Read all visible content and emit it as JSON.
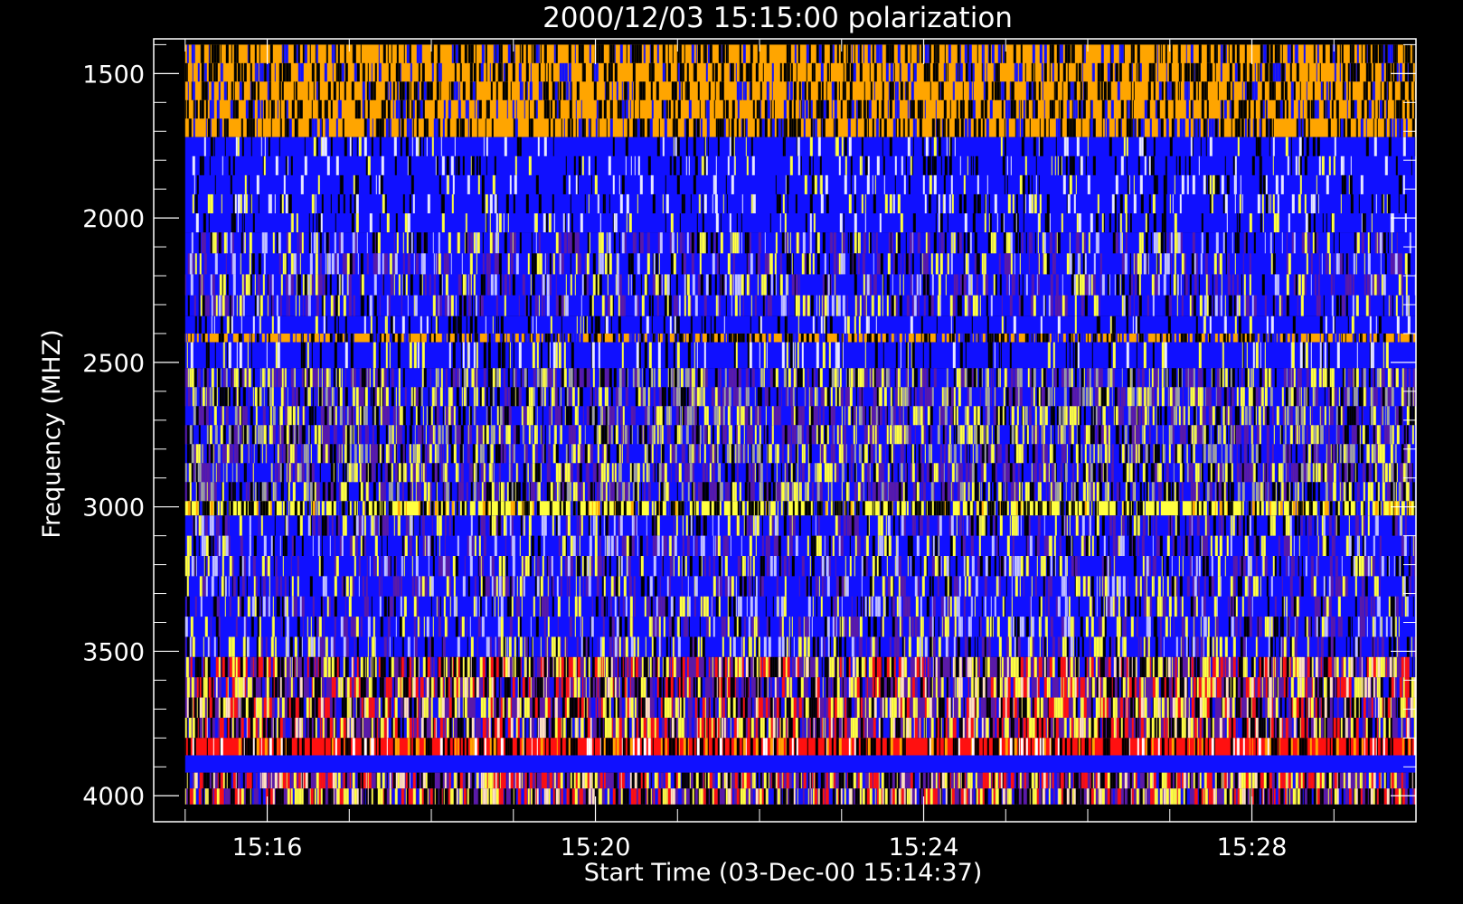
{
  "chart_data": {
    "type": "heatmap",
    "title": "2000/12/03 15:15:00 polarization",
    "xlabel": "Start Time (03-Dec-00 15:14:37)",
    "ylabel": "Frequency (MHZ)",
    "xlim": [
      "15:14:37",
      "15:30:00"
    ],
    "ylim": [
      4090,
      1380
    ],
    "data_extent": {
      "time": [
        "15:15:00",
        "15:30:00"
      ],
      "frequency_mhz": [
        1400,
        4030
      ]
    },
    "x_ticks": [
      "15:16",
      "15:20",
      "15:24",
      "15:28"
    ],
    "y_ticks": [
      1500,
      2000,
      2500,
      3000,
      3500,
      4000
    ],
    "grid": false,
    "colors": {
      "background": "#000000",
      "axes": "#ffffff",
      "blue": "#1010ff",
      "orange": "#ffa500",
      "yellow": "#ffff40",
      "red": "#ff1010",
      "purple": "#5a1aa8"
    },
    "bands": [
      {
        "from": 1400,
        "to": 1720,
        "palette": "orange"
      },
      {
        "from": 1720,
        "to": 2050,
        "palette": "blue"
      },
      {
        "from": 2050,
        "to": 2340,
        "palette": "blue-mix"
      },
      {
        "from": 2340,
        "to": 2400,
        "palette": "blue"
      },
      {
        "from": 2400,
        "to": 2430,
        "palette": "orange-mix"
      },
      {
        "from": 2430,
        "to": 2520,
        "palette": "blue"
      },
      {
        "from": 2520,
        "to": 2980,
        "palette": "purple-mix"
      },
      {
        "from": 2980,
        "to": 3030,
        "palette": "yellow-mix"
      },
      {
        "from": 3030,
        "to": 3520,
        "palette": "blue-mix"
      },
      {
        "from": 3520,
        "to": 3800,
        "palette": "red-mix"
      },
      {
        "from": 3800,
        "to": 3860,
        "palette": "red"
      },
      {
        "from": 3860,
        "to": 3920,
        "palette": "blue-solid"
      },
      {
        "from": 3920,
        "to": 4030,
        "palette": "red-mix"
      }
    ]
  }
}
